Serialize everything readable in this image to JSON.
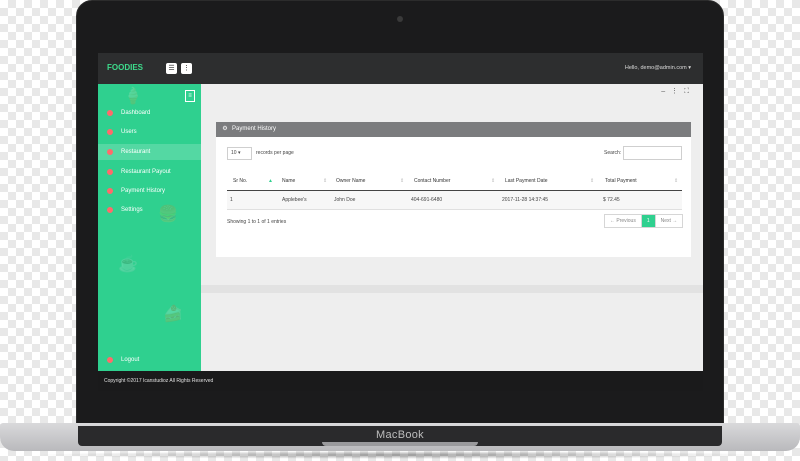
{
  "device": {
    "brand": "MacBook"
  },
  "app": {
    "logo": "FOODIES",
    "toolbar": {
      "menu_icon": "hamburger-icon",
      "more_icon": "vertical-dots-icon"
    },
    "user_menu": "Hello, demo@admin.com ▾"
  },
  "sidebar": {
    "items": [
      {
        "label": "Dashboard"
      },
      {
        "label": "Users"
      },
      {
        "label": "Restaurant"
      },
      {
        "label": "Restaurant Payout"
      },
      {
        "label": "Payment History"
      },
      {
        "label": "Settings"
      }
    ],
    "logout": "Logout",
    "accent": "#2fd08f"
  },
  "panel": {
    "title": "Payment History",
    "length_value": "10 ▾",
    "length_label": "records per page",
    "search_label": "Search:",
    "table": {
      "columns": [
        "Sr No.",
        "Name",
        "Owner Name",
        "Contact Number",
        "Last Payment Date",
        "Total Payment"
      ],
      "rows": [
        [
          "1",
          "Applebee's",
          "John Doe",
          "404-691-6480",
          "2017-11-28 14:37:45",
          "$ 72.45"
        ]
      ]
    },
    "info": "Showing 1 to 1 of 1 entries",
    "pager": {
      "prev": "← Previous",
      "current": "1",
      "next": "Next →"
    }
  },
  "footer": {
    "copyright": "Copyright ©2017 Icanstudioz All Rights Reserved"
  }
}
